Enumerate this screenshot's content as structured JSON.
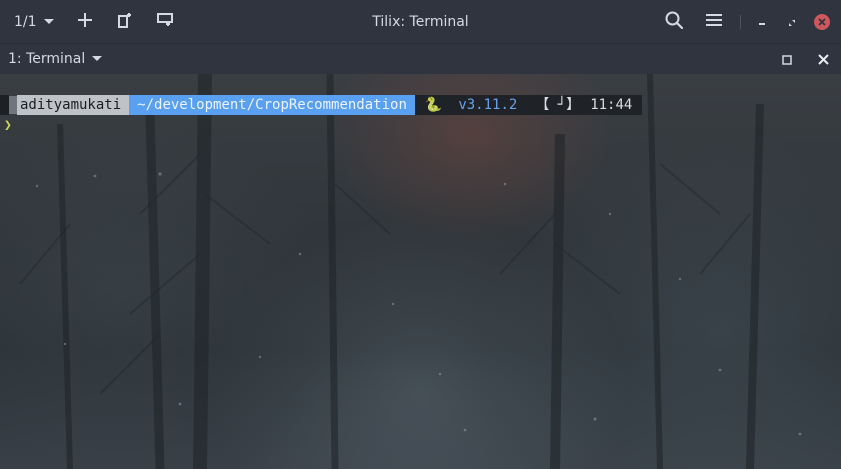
{
  "window": {
    "title": "Tilix: Terminal"
  },
  "headerbar": {
    "session_count": "1/1",
    "icons": {
      "session_dropdown": "chevron-down-icon",
      "add_terminal": "plus-icon",
      "add_right": "split-right-icon",
      "add_down": "split-down-icon",
      "search": "search-icon",
      "menu": "hamburger-menu-icon",
      "minimize": "minimize-icon",
      "restore": "restore-icon",
      "close": "close-icon"
    }
  },
  "terminal_bar": {
    "title": "1: Terminal",
    "icons": {
      "dropdown": "chevron-down-icon",
      "maximize": "maximize-icon",
      "close": "close-icon"
    }
  },
  "terminal": {
    "prompt": {
      "user": "adityamukati",
      "path": "~/development/CropRecommendation",
      "python_icon": "🐍",
      "python_version": "v3.11.2",
      "bracket": "【 ┘】",
      "time": "11:44"
    },
    "second_prompt": "❯"
  },
  "colors": {
    "headerbar_bg": "#2f343f",
    "text": "#d3dae3",
    "close_button": "#cc575d",
    "path_segment": "#5aa0f0",
    "user_segment": "#bfc3c8",
    "version_text": "#6aa0e8",
    "prompt_char": "#d0d75a"
  }
}
